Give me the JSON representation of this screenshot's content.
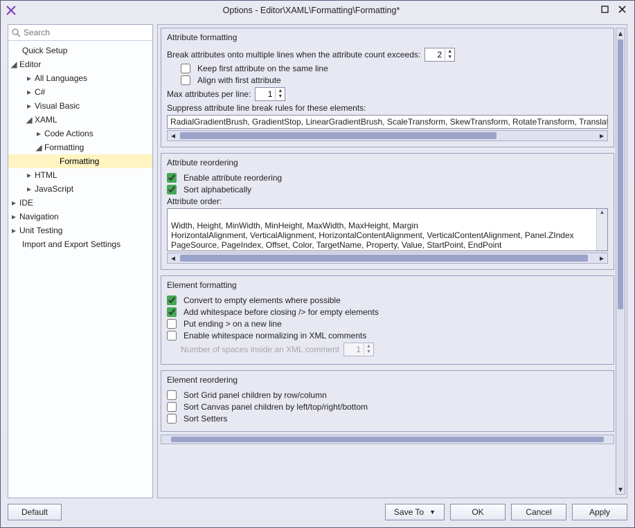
{
  "window": {
    "title": "Options - Editor\\XAML\\Formatting\\Formatting*"
  },
  "search": {
    "placeholder": "Search"
  },
  "tree": {
    "quick_setup": "Quick Setup",
    "editor": "Editor",
    "all_languages": "All Languages",
    "csharp": "C#",
    "visual_basic": "Visual Basic",
    "xaml": "XAML",
    "code_actions": "Code Actions",
    "formatting_parent": "Formatting",
    "formatting": "Formatting",
    "html": "HTML",
    "javascript": "JavaScript",
    "ide": "IDE",
    "navigation": "Navigation",
    "unit_testing": "Unit Testing",
    "import_export": "Import and Export Settings"
  },
  "groups": {
    "attr_fmt": {
      "title": "Attribute formatting",
      "break_label": "Break attributes onto multiple lines when the attribute count exceeds:",
      "break_value": "2",
      "keep_first": "Keep first attribute on the same line",
      "align_first": "Align with first attribute",
      "max_per_line_label": "Max attributes per line:",
      "max_per_line_value": "1",
      "suppress_label": "Suppress attribute line break rules for these elements:",
      "suppress_value": "RadialGradientBrush, GradientStop, LinearGradientBrush, ScaleTransform, SkewTransform, RotateTransform, Translate"
    },
    "attr_reorder": {
      "title": "Attribute reordering",
      "enable": "Enable attribute reordering",
      "sort_alpha": "Sort alphabetically",
      "order_label": "Attribute order:",
      "order_value": "Width, Height, MinWidth, MinHeight, MaxWidth, MaxHeight, Margin\nHorizontalAlignment, VerticalAlignment, HorizontalContentAlignment, VerticalContentAlignment, Panel.ZIndex\nPageSource, PageIndex, Offset, Color, TargetName, Property, Value, StartPoint, EndPoint\nmc:Ignorable, d:IsDataSource, d:LayoutOverrides, d:IsStaticText"
    },
    "elem_fmt": {
      "title": "Element formatting",
      "convert_empty": "Convert to empty elements where possible",
      "ws_before_close": "Add whitespace before closing /> for empty elements",
      "ending_newline": "Put ending > on a new line",
      "ws_normalize": "Enable whitespace normalizing in XML comments",
      "comment_spaces_label": "Number of spaces inside an XML comment",
      "comment_spaces_value": "1"
    },
    "elem_reorder": {
      "title": "Element reordering",
      "sort_grid": "Sort Grid panel children by row/column",
      "sort_canvas": "Sort Canvas panel children by left/top/right/bottom",
      "sort_setters": "Sort Setters"
    }
  },
  "footer": {
    "default": "Default",
    "save_to": "Save To",
    "ok": "OK",
    "cancel": "Cancel",
    "apply": "Apply"
  }
}
